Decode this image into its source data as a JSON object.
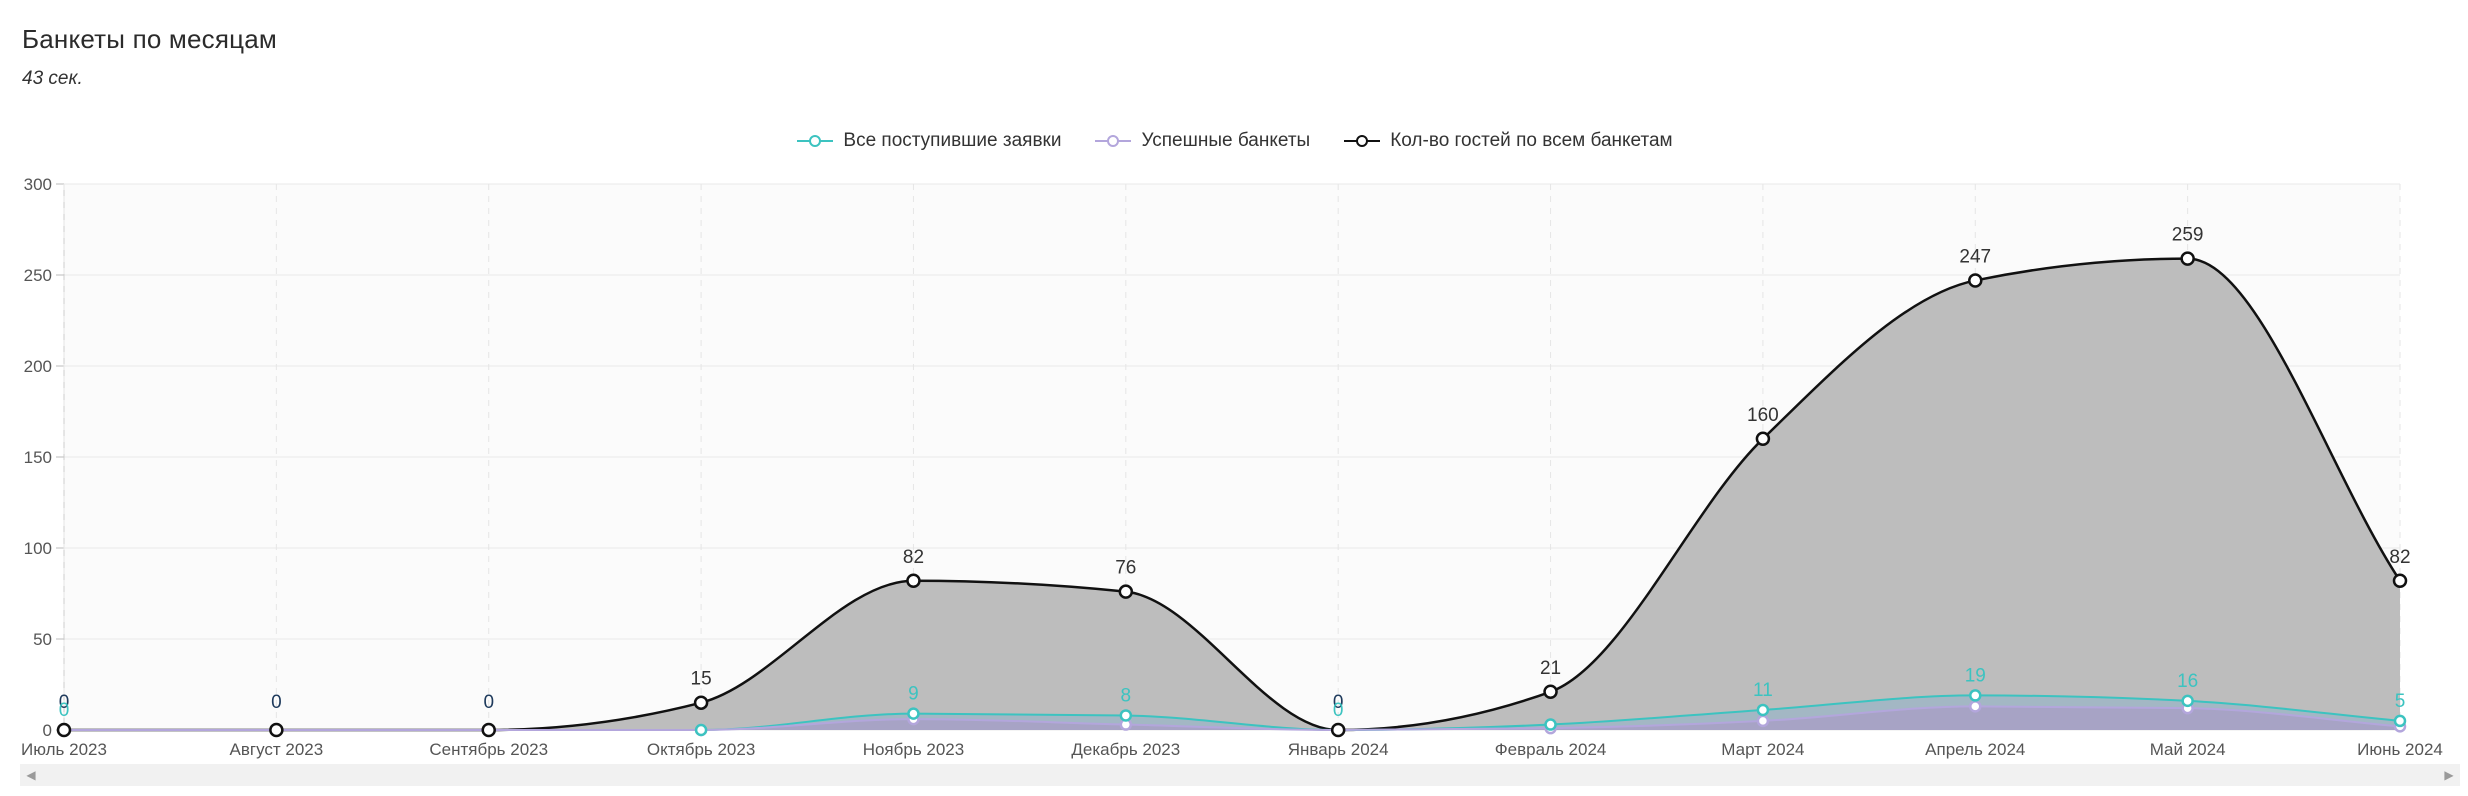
{
  "widget": {
    "title": "Банкеты по месяцам",
    "subtitle": "43 сек."
  },
  "colors": {
    "requests": "#3cc3c0",
    "success": "#b3a6dc",
    "guests": "#111111",
    "guests_area": "#bdbdbd",
    "requests_area": "#9fb6c6",
    "success_area": "#a8a0c6"
  },
  "scrollbar": {
    "left_icon": "arrow-left-icon",
    "right_icon": "arrow-right-icon"
  },
  "chart_data": {
    "type": "area",
    "categories": [
      "Июль 2023",
      "Август 2023",
      "Сентябрь 2023",
      "Октябрь 2023",
      "Ноябрь 2023",
      "Декабрь 2023",
      "Январь 2024",
      "Февраль 2024",
      "Март 2024",
      "Апрель 2024",
      "Май 2024",
      "Июнь 2024"
    ],
    "series": [
      {
        "name": "Все поступившие заявки",
        "key": "requests",
        "values": [
          0,
          0,
          0,
          0,
          9,
          8,
          0,
          3,
          11,
          19,
          16,
          5
        ],
        "labels": [
          "0",
          "",
          "",
          "",
          "9",
          "8",
          "0",
          "",
          "11",
          "19",
          "16",
          "5"
        ]
      },
      {
        "name": "Успешные банкеты",
        "key": "success",
        "values": [
          0,
          0,
          0,
          0,
          6,
          3,
          0,
          1,
          5,
          13,
          12,
          2
        ],
        "labels": [
          "",
          "",
          "",
          "",
          "",
          "",
          "",
          "",
          "",
          "",
          "",
          ""
        ]
      },
      {
        "name": "Кол-во гостей по всем банкетам",
        "key": "guests",
        "values": [
          0,
          0,
          0,
          15,
          82,
          76,
          0,
          21,
          160,
          247,
          259,
          82
        ],
        "labels": [
          "0",
          "0",
          "0",
          "15",
          "82",
          "76",
          "0",
          "21",
          "160",
          "247",
          "259",
          "82"
        ]
      }
    ],
    "yticks": [
      "300",
      "250",
      "200",
      "150",
      "100",
      "50",
      "0"
    ],
    "ylim": [
      0,
      300
    ],
    "grid": true,
    "legend": "top-center"
  }
}
